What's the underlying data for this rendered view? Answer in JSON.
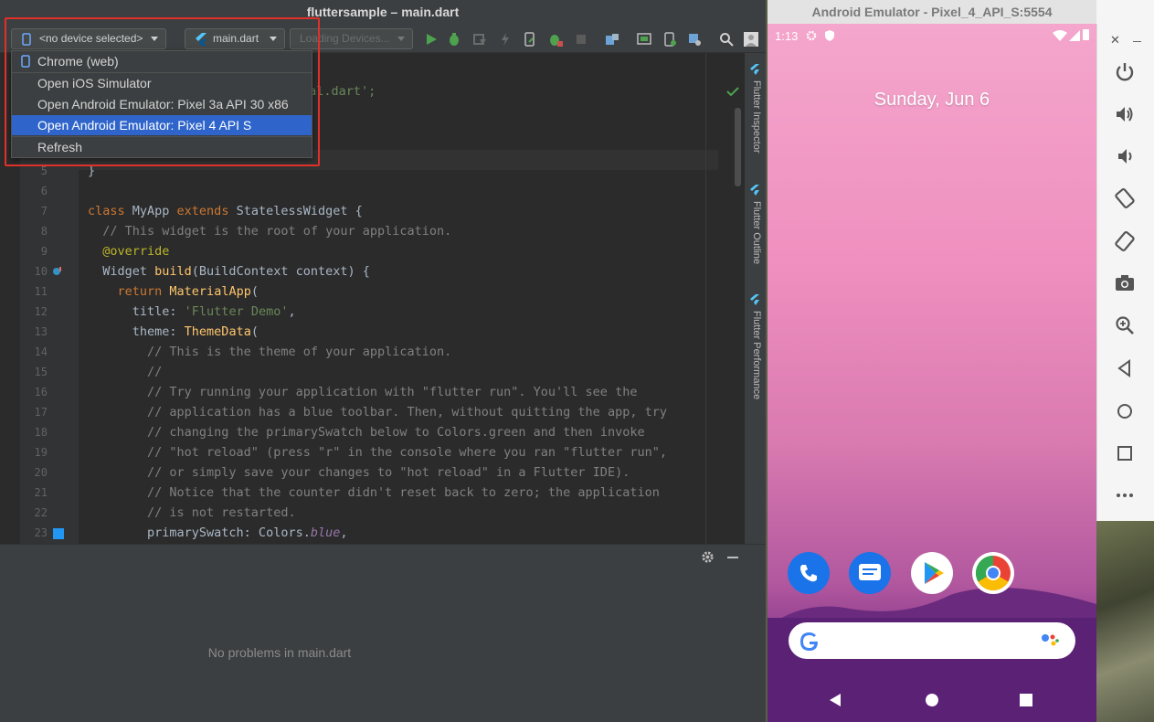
{
  "ide": {
    "window_title": "fluttersample – main.dart",
    "toolbar": {
      "device_selector": "<no device selected>",
      "run_config": "main.dart",
      "loading_devices": "Loading Devices..."
    },
    "device_menu": [
      {
        "label": "Chrome (web)"
      },
      {
        "label": "Open iOS Simulator"
      },
      {
        "label": "Open Android Emulator: Pixel 3a API 30 x86"
      },
      {
        "label": "Open Android Emulator: Pixel 4 API S"
      },
      {
        "label": "Refresh"
      }
    ],
    "partial_import": "ial.dart';",
    "line_numbers": [
      "5",
      "6",
      "7",
      "8",
      "9",
      "10",
      "11",
      "12",
      "13",
      "14",
      "15",
      "16",
      "17",
      "18",
      "19",
      "20",
      "21",
      "22",
      "23"
    ],
    "code": {
      "l5": "}",
      "l7_kw1": "class",
      "l7_a": " MyApp ",
      "l7_kw2": "extends",
      "l7_b": " StatelessWidget {",
      "l8": "  // This widget is the root of your application.",
      "l9": "  @override",
      "l10_a": "  Widget ",
      "l10_fn": "build",
      "l10_b": "(BuildContext context) {",
      "l11_kw": "    return",
      "l11_a": " ",
      "l11_cls": "MaterialApp",
      "l11_b": "(",
      "l12_a": "      title: ",
      "l12_str": "'Flutter Demo'",
      "l12_b": ",",
      "l13_a": "      theme: ",
      "l13_cls": "ThemeData",
      "l13_b": "(",
      "l14": "        // This is the theme of your application.",
      "l15": "        //",
      "l16": "        // Try running your application with \"flutter run\". You'll see the",
      "l17": "        // application has a blue toolbar. Then, without quitting the app, try",
      "l18": "        // changing the primarySwatch below to Colors.green and then invoke",
      "l19": "        // \"hot reload\" (press \"r\" in the console where you ran \"flutter run\",",
      "l20": "        // or simply save your changes to \"hot reload\" in a Flutter IDE).",
      "l21": "        // Notice that the counter didn't reset back to zero; the application",
      "l22": "        // is not restarted.",
      "l23_a": "        primarySwatch: Colors.",
      "l23_fld": "blue",
      "l23_b": ","
    },
    "side_tabs": [
      "Flutter Inspector",
      "Flutter Outline",
      "Flutter Performance"
    ],
    "problems_message": "No problems in main.dart"
  },
  "emulator": {
    "window_title": "Android Emulator - Pixel_4_API_S:5554",
    "status_time": "1:13",
    "date": "Sunday, Jun 6",
    "side_controls": [
      "power-icon",
      "volume-up-icon",
      "volume-down-icon",
      "rotate-left-icon",
      "rotate-right-icon",
      "camera-icon",
      "zoom-icon",
      "back-icon",
      "home-icon",
      "overview-icon",
      "more-icon"
    ]
  }
}
